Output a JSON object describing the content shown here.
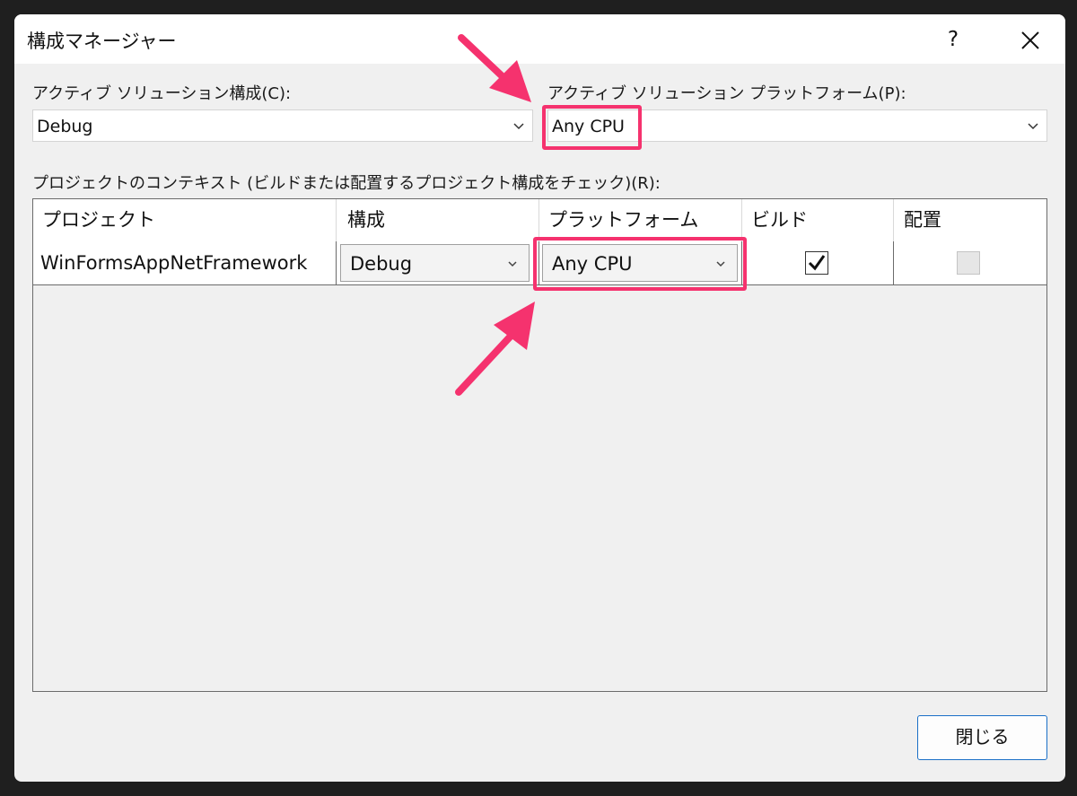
{
  "window": {
    "title": "構成マネージャー",
    "help_label": "?"
  },
  "solution_config": {
    "label": "アクティブ ソリューション構成(C):",
    "value": "Debug"
  },
  "solution_platform": {
    "label": "アクティブ ソリューション プラットフォーム(P):",
    "value": "Any CPU"
  },
  "project_context": {
    "label": "プロジェクトのコンテキスト (ビルドまたは配置するプロジェクト構成をチェック)(R):",
    "columns": [
      "プロジェクト",
      "構成",
      "プラットフォーム",
      "ビルド",
      "配置"
    ],
    "rows": [
      {
        "project": "WinFormsAppNetFramework",
        "configuration": "Debug",
        "platform": "Any CPU",
        "build_checked": true,
        "deploy_checked": false
      }
    ]
  },
  "footer": {
    "close_label": "閉じる"
  },
  "colors": {
    "highlight": "#f5326e",
    "accent": "#1a6fc7"
  }
}
